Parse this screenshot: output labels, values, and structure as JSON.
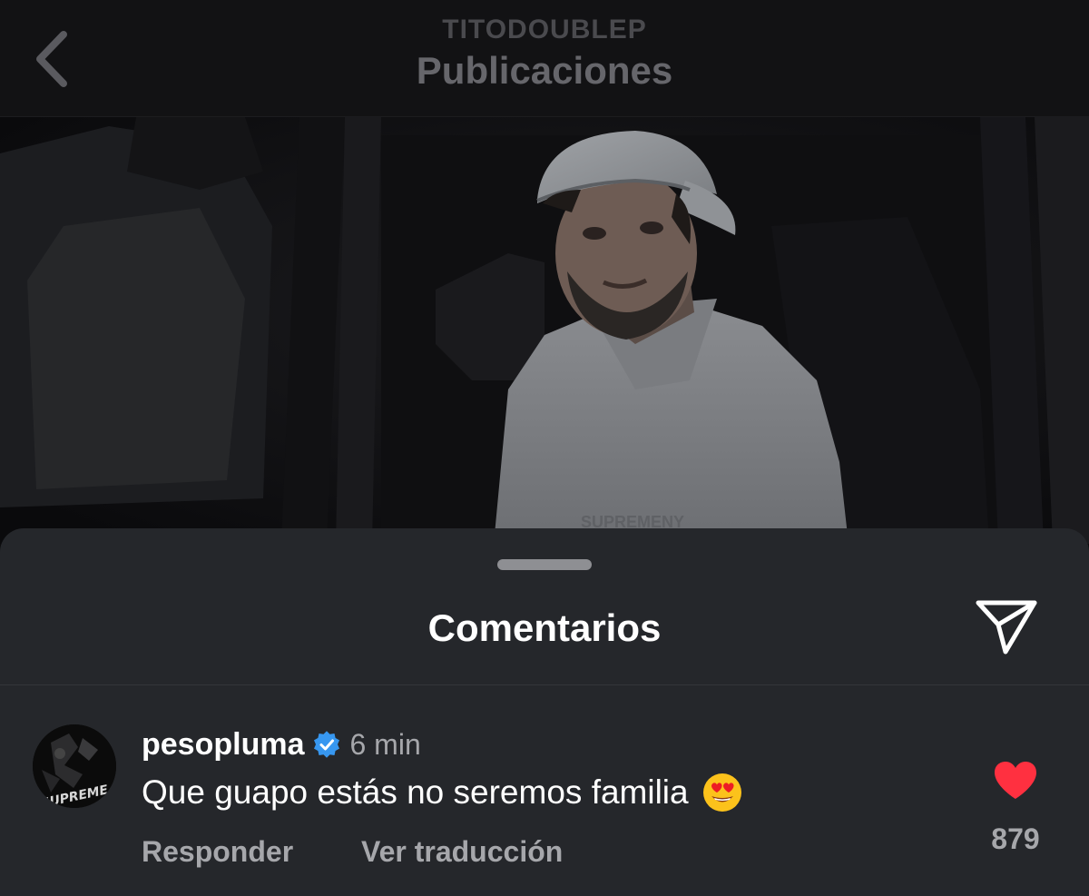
{
  "header": {
    "username": "TITODOUBLEP",
    "title": "Publicaciones",
    "back_icon": "chevron-left-icon"
  },
  "comments_sheet": {
    "title": "Comentarios",
    "share_icon": "paper-plane-icon"
  },
  "comment": {
    "username": "pesopluma",
    "verified": true,
    "verified_color": "#3797f0",
    "time": "6 min",
    "text": "Que guapo estás no seremos familia",
    "emoji": "😍",
    "reply_label": "Responder",
    "translate_label": "Ver traducción",
    "like_icon": "heart-filled-icon",
    "like_color": "#ff3040",
    "like_count": "879"
  },
  "avatar_logo_text": "SUPREME",
  "post_logo_text": "SUPREMENY"
}
